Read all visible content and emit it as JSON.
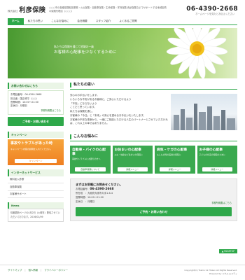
{
  "header": {
    "logo_small": "株式会社",
    "logo_big": "利彦保険",
    "tagline": "○○○市の各種保険取扱業務・火災保険・自動車保険・生命保険・学資保険 西武保険などでサポートする地域密着の保険代理店（○○○）",
    "phone": "06-4390-2668",
    "phone_sub": "ホームページを見たとお伝えください"
  },
  "nav": {
    "items": [
      "ホーム",
      "私たちの思い",
      "こんなお悩みに",
      "会社概要",
      "スタッフ紹介",
      "よくあるご質問"
    ]
  },
  "hero": {
    "line1": "私たちは保険を通じて地域の一員",
    "line2": "お客様の心配事を少なくするために"
  },
  "sidebar": {
    "contact": {
      "title": "お問い合わせはこちら",
      "lines": [
        "お電話番号：06-4390-2668",
        "担当者：国正修平（○○）",
        "営業時間：10:00～21:00",
        "定休日：月曜日"
      ],
      "link": "事務所概要はこちら",
      "button": "ご予約・お問い合わせ"
    },
    "campaign": {
      "title": "キャンペーン",
      "banner_title": "事故やトラブルがあった時",
      "banner_sub": "キャンペーン内容の説明を入れてください。",
      "banner_button": "キャンペーン"
    },
    "internet": {
      "title": "インターネットサービス",
      "items": [
        "無料加入診断",
        "自動車保険",
        "お客様サポート"
      ]
    },
    "news": {
      "title": "News",
      "body": "情報更新ページの4月2日（火曜日）配信させていただいております。2016/01/09"
    }
  },
  "main": {
    "omoi": {
      "title": "私たちの思い",
      "text": [
        "安心のお手伝いをします。",
        "いろいろな不安があるお客様に、ご安心いただけるよう",
        "「不安」にならないよう",
        "ことだと思っています。",
        "",
        "私たちは保険を通し、",
        "お客様の「今日」と「未来」の安心を重ねるお手伝いをいたします。",
        "",
        "お客様の不安な事案から、一緒にご相談いただける人生のパートナーとさせていただければ、これ以上の幸せはありません。"
      ]
    },
    "nayami": {
      "title": "こんなお悩みに",
      "cards": [
        {
          "title": "自動車・バイクの心配事",
          "sub": "事故やトラブルにお困りの方へ",
          "button": "自動車保険について"
        },
        {
          "title": "お住まいの心配事",
          "sub": "火災・地震など住まいの保障に",
          "button": "詳細メニュー"
        },
        {
          "title": "病気・ケガの心配事",
          "sub": "もしもの時の医療の保障に",
          "button": "詳細メニュー"
        },
        {
          "title": "お子様の心配事",
          "sub": "子どもの将来の保障のために",
          "button": "詳細メニュー"
        }
      ]
    },
    "consult": {
      "title": "まずはお気軽にお問合せください。",
      "tel_label": "お電話番号：",
      "tel": "06-4390-2668",
      "address": "所在地　：大阪府大阪市大手1-6-4",
      "hours": "営業時間：10:00～21:00",
      "holiday": "定休日　：月曜日",
      "link": "事務所概要はこちら",
      "button": "ご予約・お問い合わせ"
    }
  },
  "pagetop": "▲ PAGETOP",
  "footer": {
    "links": [
      "サイトマップ",
      "個人情報",
      "プライバシーポリシー"
    ],
    "copy1": "Copyright(C) Toshio Uk Hoken All Rights Reserved.",
    "copy2": "Powered by リクル.エスティ"
  }
}
